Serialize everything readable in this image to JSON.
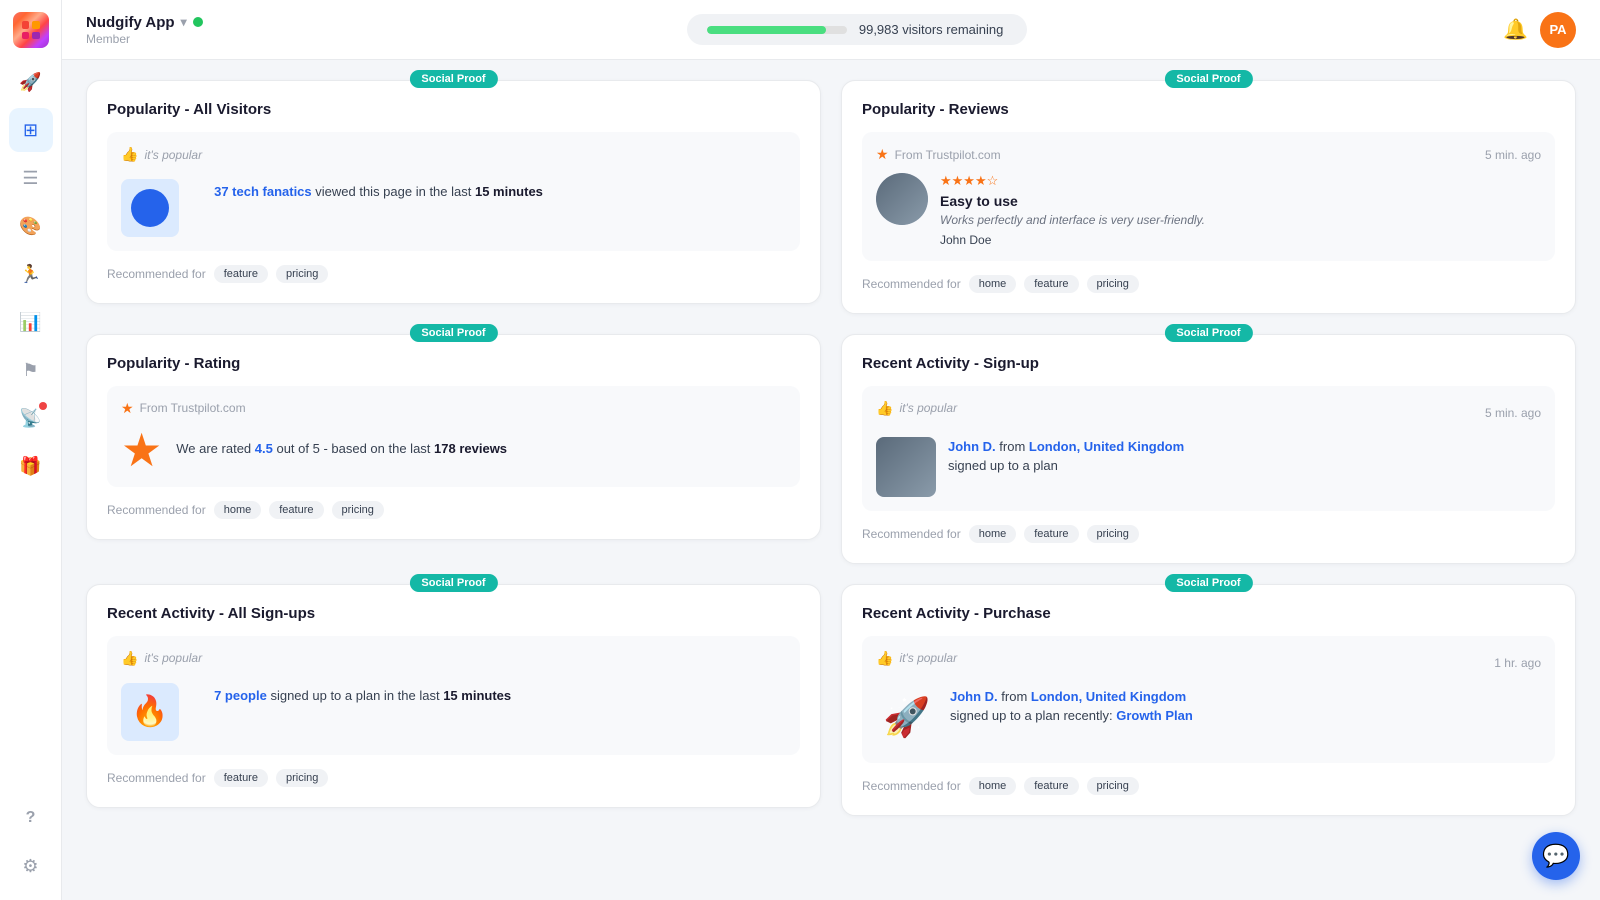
{
  "app": {
    "name": "Nudgify App",
    "name_dropdown": "▾",
    "member_label": "Member",
    "status": "online",
    "avatar_initials": "PA",
    "visitors_remaining": "99,983 visitors remaining",
    "progress_percent": 85
  },
  "sidebar": {
    "items": [
      {
        "icon": "🚀",
        "name": "launch",
        "active": false
      },
      {
        "icon": "⊞",
        "name": "dashboard",
        "active": true
      },
      {
        "icon": "☰",
        "name": "list",
        "active": false
      },
      {
        "icon": "🎨",
        "name": "design",
        "active": false
      },
      {
        "icon": "🏃",
        "name": "activity",
        "active": false
      },
      {
        "icon": "📊",
        "name": "analytics",
        "active": false
      },
      {
        "icon": "⚑",
        "name": "flags",
        "active": false
      },
      {
        "icon": "📡",
        "name": "live",
        "active": false,
        "badge": true
      },
      {
        "icon": "🎁",
        "name": "gifts",
        "active": false
      }
    ],
    "bottom_items": [
      {
        "icon": "?",
        "name": "help",
        "active": false
      },
      {
        "icon": "⚙",
        "name": "settings",
        "active": false
      }
    ]
  },
  "social_proof_badge": "Social Proof",
  "cards": [
    {
      "id": "popularity-all-visitors",
      "title": "Popularity - All Visitors",
      "badge": "Social Proof",
      "notif": {
        "popular_label": "it's popular",
        "bg_color": "#dbeafe",
        "text_before": " ",
        "highlight": "37 tech fanatics",
        "text_after": " viewed this page in the last ",
        "text_bold": "15 minutes"
      },
      "recommended_for": [
        "feature",
        "pricing"
      ]
    },
    {
      "id": "popularity-reviews",
      "title": "Popularity - Reviews",
      "badge": "Social Proof",
      "notif": {
        "source": "From Trustpilot.com",
        "time": "5 min. ago",
        "stars": "★★★★☆",
        "review_title": "Easy to use",
        "review_body": "Works perfectly and interface is very user-friendly.",
        "reviewer": "John Doe"
      },
      "recommended_for": [
        "home",
        "feature",
        "pricing"
      ]
    },
    {
      "id": "popularity-rating",
      "title": "Popularity - Rating",
      "badge": "Social Proof",
      "notif": {
        "source": "From Trustpilot.com",
        "text_before": "We are rated ",
        "highlight": "4.5",
        "text_after": " out of 5 - based on the last ",
        "text_bold": "178 reviews"
      },
      "recommended_for": [
        "home",
        "feature",
        "pricing"
      ]
    },
    {
      "id": "recent-activity-signup",
      "title": "Recent Activity - Sign-up",
      "badge": "Social Proof",
      "notif": {
        "popular_label": "it's popular",
        "time": "5 min. ago",
        "person_name": "John D.",
        "from_text": "from",
        "location": "London, United Kingdom",
        "action": "signed up to a plan"
      },
      "recommended_for": [
        "home",
        "feature",
        "pricing"
      ]
    },
    {
      "id": "recent-activity-all-signups",
      "title": "Recent Activity - All Sign-ups",
      "badge": "Social Proof",
      "notif": {
        "popular_label": "it's popular",
        "highlight": "7 people",
        "text_after": " signed up to a plan in the last ",
        "text_bold": "15 minutes"
      },
      "recommended_for": [
        "feature",
        "pricing"
      ]
    },
    {
      "id": "recent-activity-purchase",
      "title": "Recent Activity - Purchase",
      "badge": "Social Proof",
      "notif": {
        "popular_label": "it's popular",
        "time": "1 hr. ago",
        "person_name": "John D.",
        "from_text": "from",
        "location": "London, United Kingdom",
        "action_before": "signed up to a plan recently: ",
        "action_link": "Growth Plan"
      },
      "recommended_for": [
        "home",
        "feature",
        "pricing"
      ]
    }
  ]
}
